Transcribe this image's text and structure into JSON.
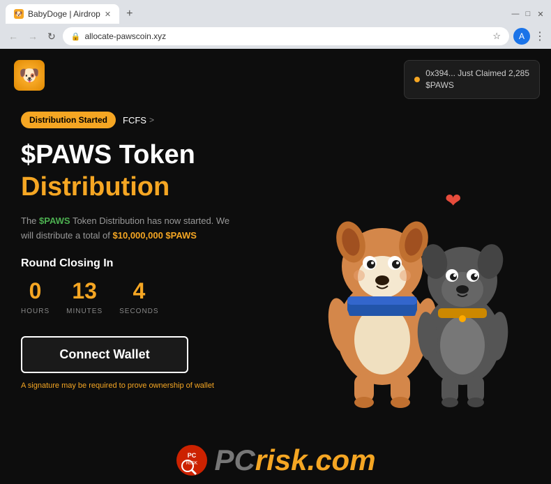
{
  "browser": {
    "tab": {
      "favicon": "🐾",
      "title": "BabyDoge | Airdrop",
      "close_icon": "✕"
    },
    "new_tab_icon": "+",
    "window_controls": {
      "minimize": "—",
      "maximize": "□",
      "close": "✕"
    },
    "nav": {
      "back": "←",
      "forward": "→",
      "reload": "↻",
      "address": "allocate-pawscoin.xyz",
      "bookmark": "☆",
      "profile_initial": "A",
      "menu": "⋮"
    }
  },
  "notification": {
    "text_line1": "0x394... Just Claimed 2,285",
    "text_line2": "$PAWS"
  },
  "logo": {
    "emoji": "🐶"
  },
  "badge": {
    "label": "Distribution Started"
  },
  "fcfs": {
    "label": "FCFS",
    "chevron": ">"
  },
  "hero": {
    "title_white": "$PAWS Token",
    "title_orange": "Distribution",
    "desc_before": "The ",
    "desc_paws": "$PAWS",
    "desc_middle": " Token Distribution has now started. We will distribute a total of ",
    "desc_amount": "$10,000,000 $PAWS",
    "round_closing": "Round Closing In"
  },
  "countdown": {
    "hours": {
      "value": "0",
      "label": "HOURS"
    },
    "minutes": {
      "value": "13",
      "label": "MINUTES"
    },
    "seconds": {
      "value": "4",
      "label": "SECONDS"
    }
  },
  "connect_button": {
    "label": "Connect Wallet"
  },
  "signature_note": {
    "text": "A signature may be required to prove ownership of wallet"
  },
  "watermark": {
    "text_gray": "PC",
    "text_orange": "risk.com"
  }
}
